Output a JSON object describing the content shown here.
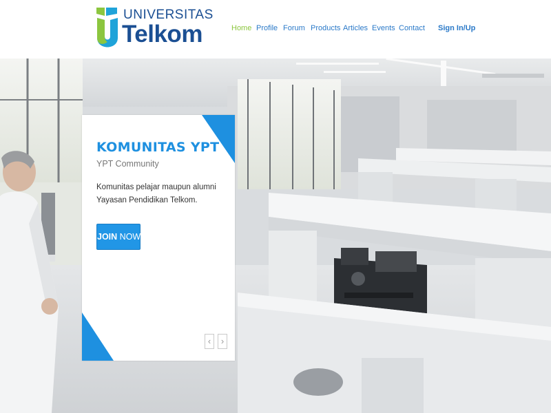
{
  "brand": {
    "top_line": "UNIVERSITAS",
    "bottom_line": "Telkom",
    "colors": {
      "blue": "#1b4f93",
      "green": "#8cc63f",
      "teal": "#1fa3d9"
    }
  },
  "nav": {
    "items": [
      {
        "label": "Home",
        "active": true
      },
      {
        "label": "Profile"
      },
      {
        "label": "Forum"
      },
      {
        "label": "Products"
      },
      {
        "label": "Articles"
      },
      {
        "label": "Events"
      },
      {
        "label": "Contact"
      }
    ],
    "signin": "Sign In/Up"
  },
  "slide": {
    "title": "KOMUNITAS YPT",
    "subtitle": "YPT Community",
    "description": "Komunitas pelajar maupun alumni Yayasan Pendidikan Telkom.",
    "button_bold": "JOIN",
    "button_light": "NOW",
    "accent": "#1e90e0",
    "prev_icon": "chevron-left-icon",
    "next_icon": "chevron-right-icon",
    "prev_glyph": "‹",
    "next_glyph": "›"
  }
}
